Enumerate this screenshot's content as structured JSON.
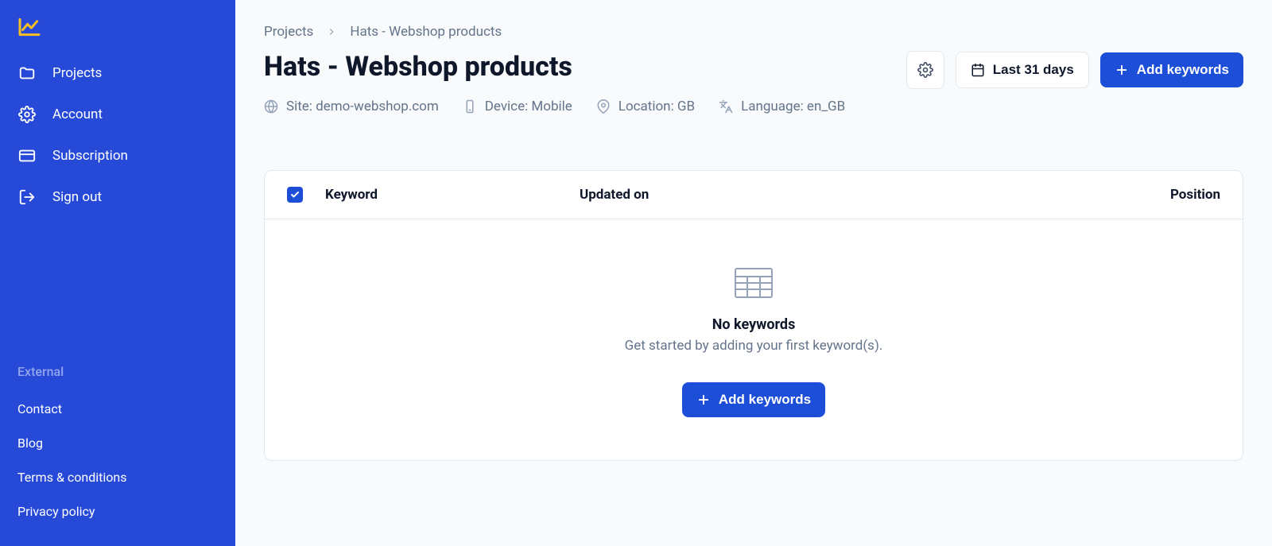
{
  "sidebar": {
    "nav": [
      {
        "label": "Projects"
      },
      {
        "label": "Account"
      },
      {
        "label": "Subscription"
      },
      {
        "label": "Sign out"
      }
    ],
    "external_heading": "External",
    "external": [
      {
        "label": "Contact"
      },
      {
        "label": "Blog"
      },
      {
        "label": "Terms & conditions"
      },
      {
        "label": "Privacy policy"
      }
    ]
  },
  "breadcrumb": {
    "items": [
      {
        "label": "Projects"
      },
      {
        "label": "Hats - Webshop products"
      }
    ]
  },
  "page": {
    "title": "Hats - Webshop products",
    "meta": {
      "site": "Site: demo-webshop.com",
      "device": "Device: Mobile",
      "location": "Location: GB",
      "language": "Language: en_GB"
    }
  },
  "actions": {
    "date_range": "Last 31 days",
    "add_keywords": "Add keywords"
  },
  "table": {
    "columns": {
      "keyword": "Keyword",
      "updated_on": "Updated on",
      "position": "Position"
    },
    "select_all_checked": true,
    "rows": []
  },
  "empty_state": {
    "title": "No keywords",
    "subtitle": "Get started by adding your first keyword(s).",
    "cta": "Add keywords"
  }
}
